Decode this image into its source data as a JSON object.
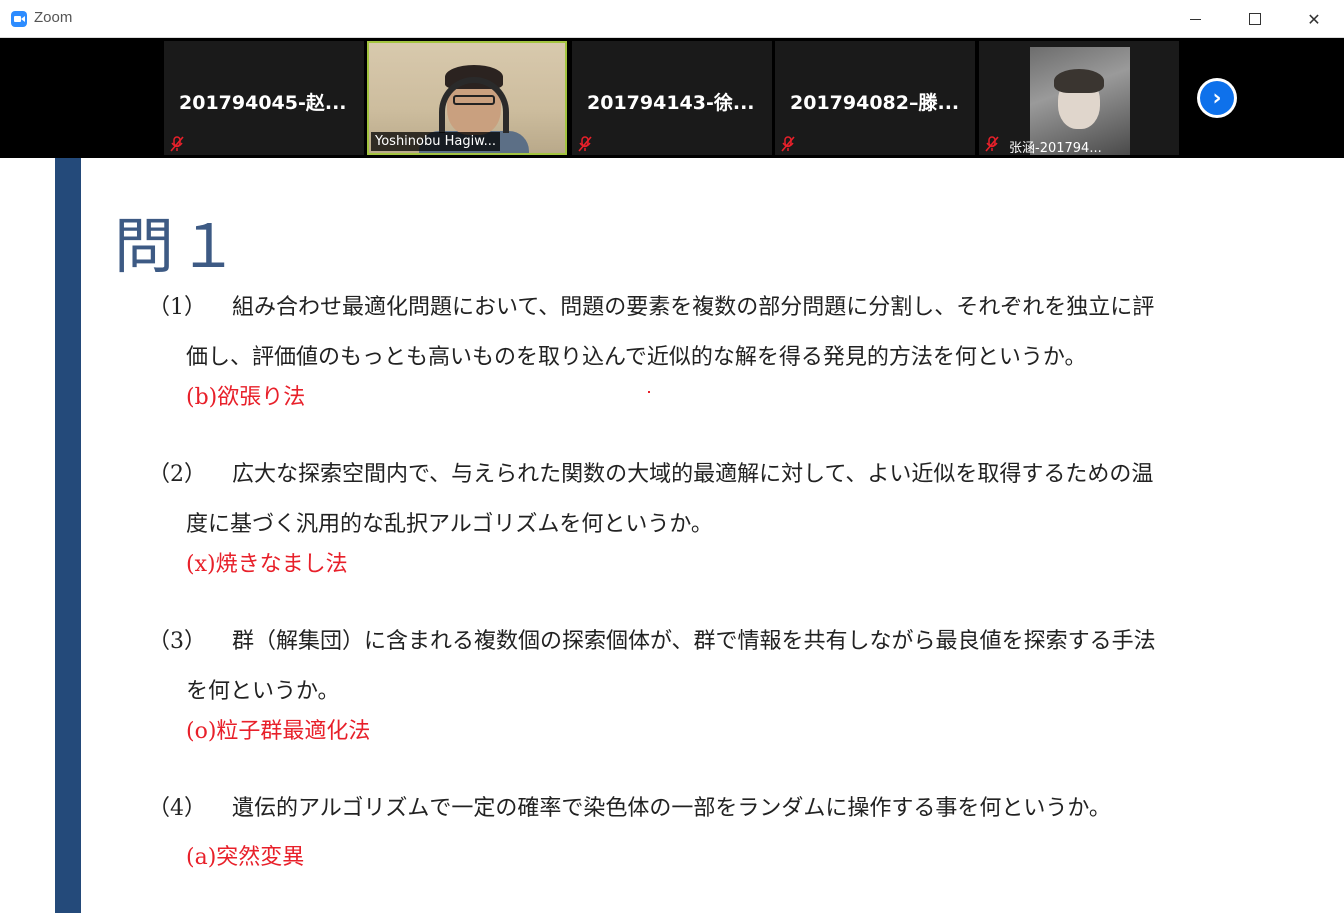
{
  "window": {
    "title": "Zoom",
    "minimize": "—",
    "maximize": "☐",
    "close": "✕"
  },
  "participants": [
    {
      "name": "201794045-赵...",
      "muted": true,
      "video": false
    },
    {
      "name": "Yoshinobu Hagiw...",
      "muted": false,
      "video": true,
      "active": true
    },
    {
      "name": "201794143-徐...",
      "muted": true,
      "video": false
    },
    {
      "name": "201794082–滕...",
      "muted": true,
      "video": false
    },
    {
      "name": "张涵-201794...",
      "muted": true,
      "video": true
    }
  ],
  "next_label": "›",
  "slide": {
    "title": "問１",
    "questions": [
      {
        "num": "（1）",
        "line1": "組み合わせ最適化問題において、問題の要素を複数の部分問題に分割し、それぞれを独立に評",
        "line2": "価し、評価値のもっとも高いものを取り込んで近似的な解を得る発見的方法を何というか。",
        "answer": "(b)欲張り法"
      },
      {
        "num": "（2）",
        "line1": "広大な探索空間内で、与えられた関数の大域的最適解に対して、よい近似を取得するための温",
        "line2": "度に基づく汎用的な乱択アルゴリズムを何というか。",
        "answer": "(x)焼きなまし法"
      },
      {
        "num": "（3）",
        "line1": "群（解集団）に含まれる複数個の探索個体が、群で情報を共有しながら最良値を探索する手法",
        "line2": "を何というか。",
        "answer": "(o)粒子群最適化法"
      },
      {
        "num": "（4）",
        "line1": "遺伝的アルゴリズムで一定の確率で染色体の一部をランダムに操作する事を何というか。",
        "line2": "",
        "answer": "(a)突然変異"
      }
    ]
  },
  "colors": {
    "accent_bar": "#244a7a",
    "title": "#3d5a84",
    "answer": "#e8202a",
    "active_border": "#a3c43f",
    "next_button": "#0e71eb"
  }
}
